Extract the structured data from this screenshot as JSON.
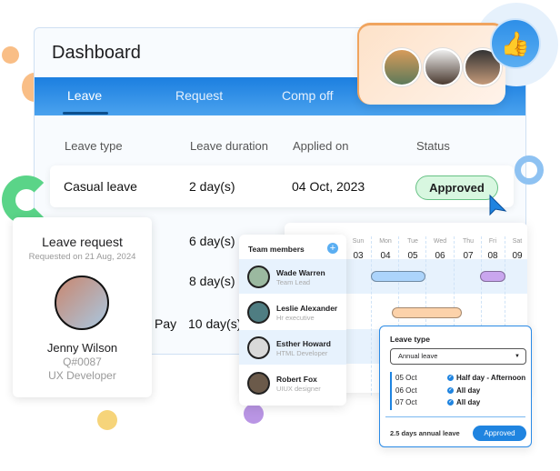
{
  "dashboard": {
    "title": "Dashboard",
    "tabs": [
      {
        "label": "Leave"
      },
      {
        "label": "Request"
      },
      {
        "label": "Comp off"
      }
    ],
    "columns": [
      "Leave type",
      "Leave duration",
      "Applied on",
      "Status"
    ],
    "rows": [
      {
        "type": "Casual leave",
        "duration": "2 day(s)",
        "applied": "04 Oct, 2023",
        "status": "Approved"
      },
      {
        "duration": "6 day(s)"
      },
      {
        "duration": "8 day(s)"
      },
      {
        "type": "Pay",
        "duration": "10 day(s)"
      }
    ]
  },
  "leave_request": {
    "title": "Leave request",
    "requested": "Requested on 21 Aug, 2024",
    "name": "Jenny Wilson",
    "id": "Q#0087",
    "role": "UX Developer"
  },
  "team": {
    "title": "Team members",
    "members": [
      {
        "name": "Wade Warren",
        "role": "Team Lead"
      },
      {
        "name": "Leslie Alexander",
        "role": "Hr executive"
      },
      {
        "name": "Esther Howard",
        "role": "HTML Developer"
      },
      {
        "name": "Robert Fox",
        "role": "UIUX designer"
      }
    ]
  },
  "calendar": {
    "days": [
      {
        "d": "Sun",
        "n": "03"
      },
      {
        "d": "Mon",
        "n": "04"
      },
      {
        "d": "Tue",
        "n": "05"
      },
      {
        "d": "Wed",
        "n": "06"
      },
      {
        "d": "Thu",
        "n": "07"
      },
      {
        "d": "Fri",
        "n": "08"
      },
      {
        "d": "Sat",
        "n": "09"
      }
    ]
  },
  "popup": {
    "label": "Leave type",
    "select": "Annual leave",
    "entries": [
      {
        "date": "05 Oct",
        "value": "Half day - Afternoon"
      },
      {
        "date": "06 Oct",
        "value": "All day"
      },
      {
        "date": "07 Oct",
        "value": "All day"
      }
    ],
    "summary": "2.5 days annual leave",
    "button": "Approved"
  },
  "colors": {
    "primary": "#1f84e0",
    "approved_bg": "#d8f7e0",
    "bar_blue": "#acd4fb",
    "bar_purple": "#c9a6ee",
    "bar_peach": "#fcd2aa"
  }
}
